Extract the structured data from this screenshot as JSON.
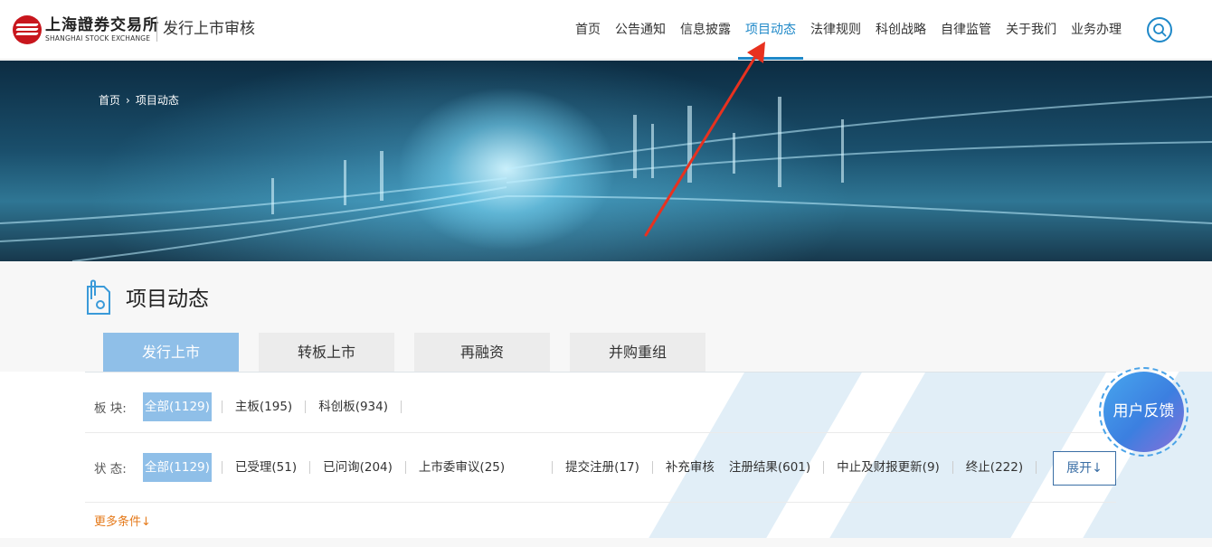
{
  "header": {
    "logo": {
      "cn": "上海證券交易所",
      "en": "SHANGHAI STOCK EXCHANGE",
      "color": "#c8161d"
    },
    "subtitle": "发行上市审核",
    "nav": [
      {
        "label": "首页"
      },
      {
        "label": "公告通知"
      },
      {
        "label": "信息披露"
      },
      {
        "label": "项目动态",
        "active": true
      },
      {
        "label": "法律规则"
      },
      {
        "label": "科创战略"
      },
      {
        "label": "自律监管"
      },
      {
        "label": "关于我们"
      },
      {
        "label": "业务办理"
      }
    ],
    "search_icon": "search-icon",
    "accent": "#1e88c8"
  },
  "banner": {
    "breadcrumb": {
      "home": "首页",
      "separator": "›",
      "current": "项目动态"
    }
  },
  "section": {
    "title": "项目动态",
    "tabs": [
      {
        "label": "发行上市",
        "active": true
      },
      {
        "label": "转板上市"
      },
      {
        "label": "再融资"
      },
      {
        "label": "并购重组"
      }
    ],
    "board_filter": {
      "label": "板 块:",
      "options": [
        {
          "label": "全部(1129)",
          "selected": true
        },
        {
          "label": "主板(195)"
        },
        {
          "label": "科创板(934)"
        }
      ]
    },
    "status_filter": {
      "label": "状 态:",
      "options": [
        {
          "label": "全部(1129)",
          "selected": true
        },
        {
          "label": "已受理(51)"
        },
        {
          "label": "已问询(204)"
        },
        {
          "label": "上市委审议(25)"
        },
        {
          "label": "提交注册(17)"
        },
        {
          "label": "补充审核"
        },
        {
          "label": "注册结果(601)"
        },
        {
          "label": "中止及财报更新(9)"
        },
        {
          "label": "终止(222)"
        }
      ]
    },
    "expand_label": "展开↓",
    "more_label": "更多条件↓",
    "more_color": "#e57a1b"
  },
  "feedback": {
    "label": "用户反馈"
  },
  "annotation": {
    "color": "#e8311f",
    "target": "项目动态"
  }
}
